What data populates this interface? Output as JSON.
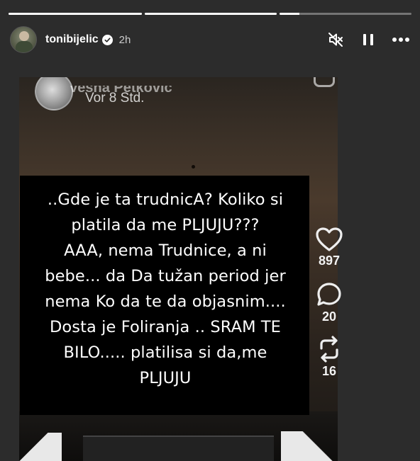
{
  "progress": [
    {
      "fill": 1.0
    },
    {
      "fill": 1.0
    },
    {
      "fill": 0.15
    }
  ],
  "header": {
    "username": "tonibijelic",
    "time": "2h",
    "icons": [
      "verified-icon",
      "mute-icon",
      "pause-icon",
      "more-icon"
    ]
  },
  "inner_post": {
    "name": "Vesna Petković",
    "time": "Vor 8 Std.",
    "rail": {
      "likes": "897",
      "comments": "20",
      "reposts": "16"
    }
  },
  "caption": {
    "text": "..Gde je ta trudnicA?  Koliko si\nplatila da me PLJUJU???\nAAA, nema Trudnice, a ni\nbebe... da Da tužan period jer\nnema Ko da te  da objasnim....\nDosta je Foliranja .. SRAM TE\nBILO.....  platilisa si da,me\nPLJUJU"
  },
  "colors": {
    "background": "#262626",
    "caption_bg": "#000000",
    "text": "#ffffff"
  }
}
